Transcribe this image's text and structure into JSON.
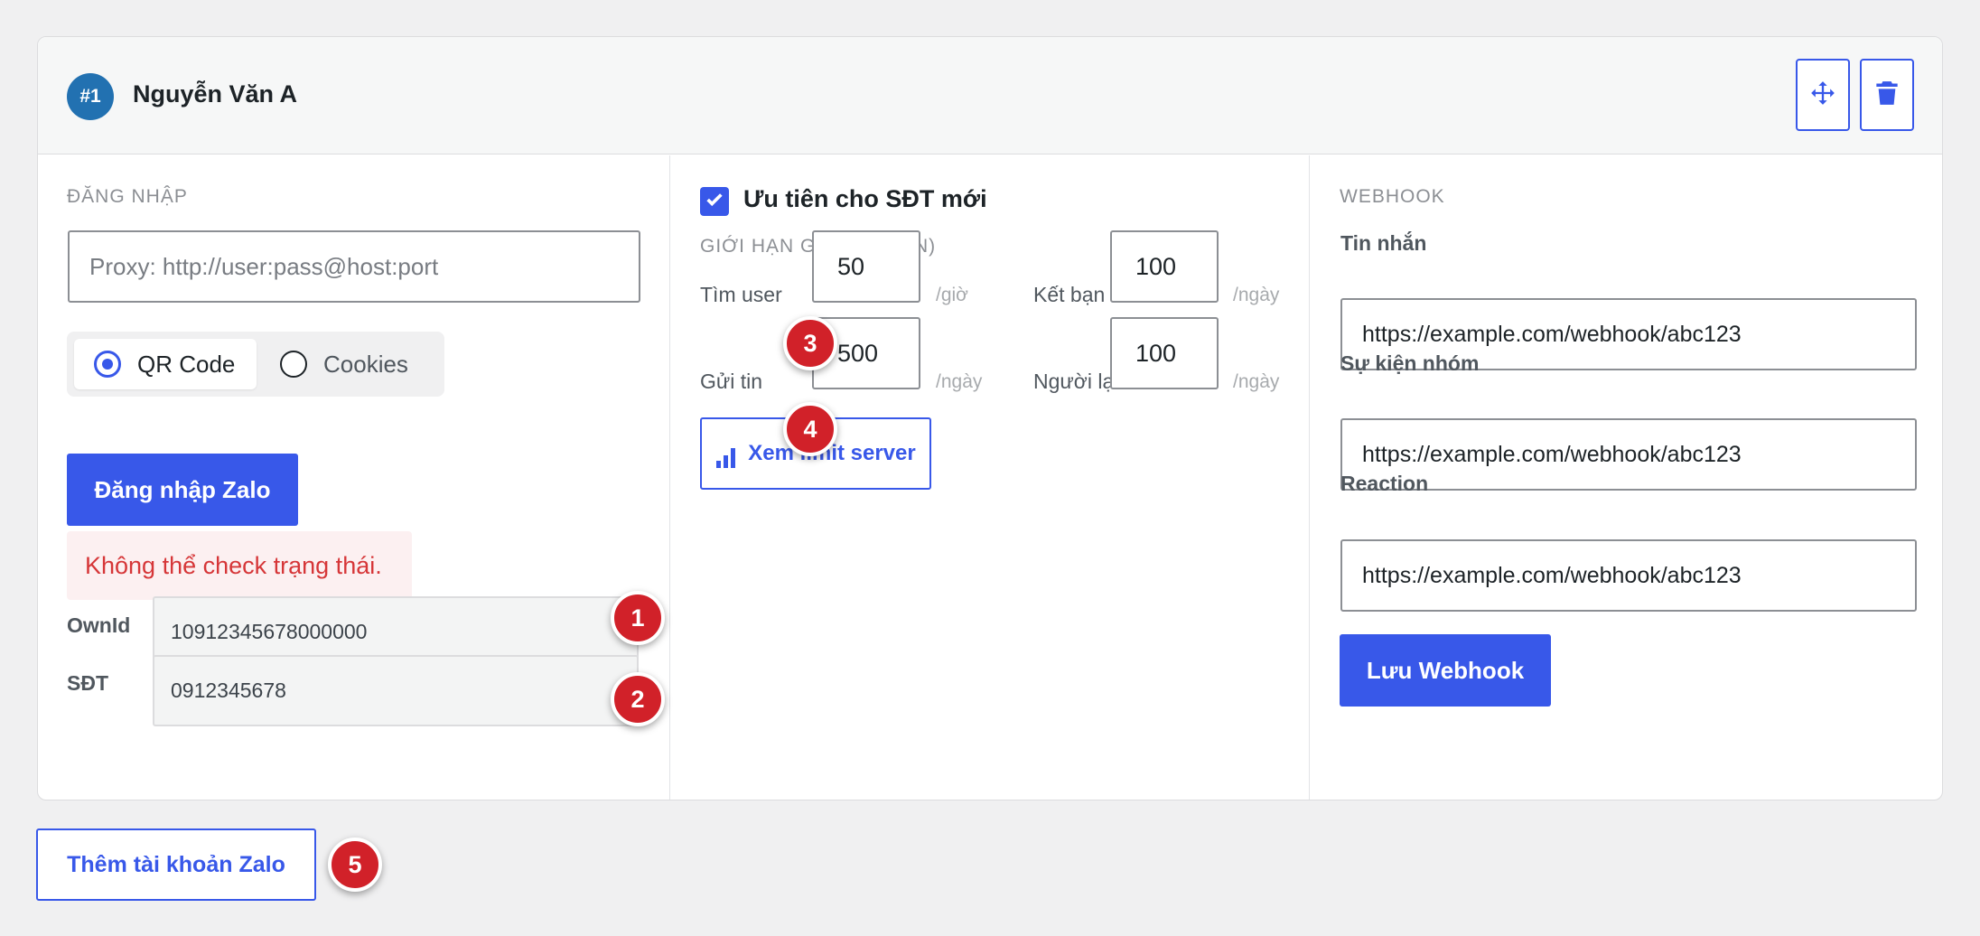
{
  "account": {
    "badge": "#1",
    "name": "Nguyễn Văn A"
  },
  "header_icons": {
    "move": "move-arrows-icon",
    "delete": "trash-icon"
  },
  "login": {
    "section_title": "ĐĂNG NHẬP",
    "proxy_placeholder": "Proxy: http://user:pass@host:port",
    "proxy_value": "",
    "radio_options": [
      "QR Code",
      "Cookies"
    ],
    "radio_selected": "QR Code",
    "login_button": "Đăng nhập Zalo",
    "error_text": "Không thể check trạng thái.",
    "ownid_label": "OwnId",
    "ownid_value": "10912345678000000",
    "phone_label": "SĐT",
    "phone_value": "0912345678"
  },
  "limits": {
    "priority_label": "Ưu tiên cho SĐT mới",
    "priority_checked": true,
    "section_title": "GIỚI HẠN GỬI (PLUGIN)",
    "find_user_label": "Tìm user",
    "find_user_value": "50",
    "find_user_unit": "/giờ",
    "add_friend_label": "Kết bạn",
    "add_friend_value": "100",
    "add_friend_unit": "/ngày",
    "send_msg_label": "Gửi tin",
    "send_msg_value": "500",
    "send_msg_unit": "/ngày",
    "stranger_label": "Người lạ",
    "stranger_value": "100",
    "stranger_unit": "/ngày",
    "view_limit_button": "Xem limit server",
    "view_limit_icon": "bar-chart-icon"
  },
  "webhook": {
    "section_title": "WEBHOOK",
    "message_label": "Tin nhắn",
    "message_value": "https://example.com/webhook/abc123",
    "group_label": "Sự kiện nhóm",
    "group_value": "https://example.com/webhook/abc123",
    "reaction_label": "Reaction",
    "reaction_value": "https://example.com/webhook/abc123",
    "save_button": "Lưu Webhook"
  },
  "add_account_button": "Thêm tài khoản Zalo",
  "markers": [
    "1",
    "2",
    "3",
    "4",
    "5"
  ],
  "colors": {
    "accent": "#3858e9",
    "badge": "#2271b1",
    "error": "#d63638",
    "marker": "#d12129"
  }
}
